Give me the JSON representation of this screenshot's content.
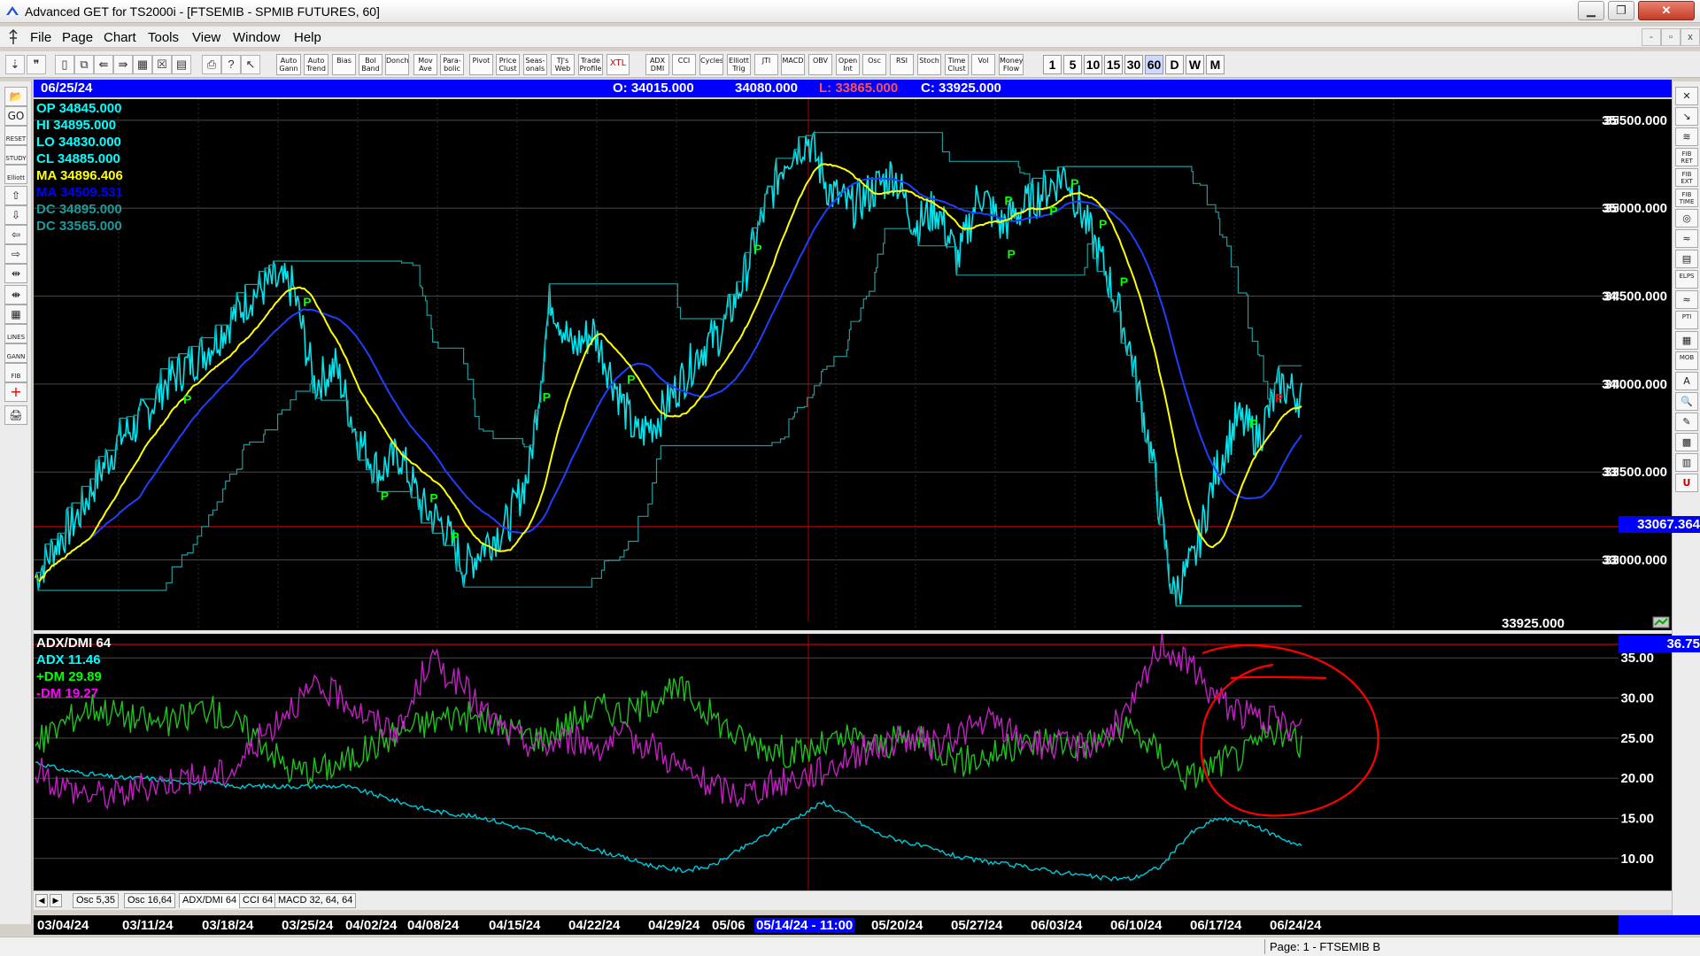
{
  "window": {
    "title": "Advanced GET for TS2000i - [FTSEMIB - SPMIB FUTURES, 60]",
    "min_label": "▁",
    "max_label": "❐",
    "close_label": "✕"
  },
  "menu": {
    "items": [
      "File",
      "Page",
      "Chart",
      "Tools",
      "View",
      "Window",
      "Help"
    ],
    "mdi_min": "-",
    "mdi_restore": "▫",
    "mdi_close": "x"
  },
  "toolbar": {
    "study_buttons": [
      "Auto Gann",
      "Auto Trend",
      "Bias",
      "Bol Band",
      "Donch",
      "Mov Ave",
      "Para- bolic",
      "Pivot",
      "Price Clust",
      "Seas- onals",
      "TJ's Web",
      "Trade Profile",
      "XTL",
      "ADX DMI",
      "CCI",
      "Cycles",
      "Elliott Trig",
      "JTI",
      "MACD",
      "OBV",
      "Open Int",
      "Osc",
      "RSI",
      "Stoch",
      "Time Clust",
      "Vol",
      "Money Flow"
    ],
    "timeframes": [
      "1",
      "5",
      "10",
      "15",
      "30",
      "60",
      "D",
      "W",
      "M"
    ],
    "active_timeframe": "60"
  },
  "left_tools": [
    "📂",
    "GO",
    "RESET",
    "STUDY",
    "Elliott",
    "⇧",
    "⇩",
    "⇦",
    "⇨",
    "⇹",
    "⇼",
    "▦",
    "LINES",
    "GANN",
    "FIB",
    "+",
    "🖨"
  ],
  "right_tools": [
    "✕",
    "↘",
    "≋",
    "FIB RET",
    "FIB EXT",
    "FIB TIME",
    "◎",
    "≈",
    "▤",
    "ELPS",
    "≈",
    "PTI",
    "▦",
    "MOB",
    "A",
    "🔍",
    "✎",
    "▩",
    "▥",
    "U"
  ],
  "header": {
    "date": "06/25/24",
    "open": "O: 34015.000",
    "high": "34080.000",
    "low": "L: 33865.000",
    "close": "C: 33925.000"
  },
  "price_legend": [
    {
      "text": "OP  34845.000",
      "color": "#00ffff"
    },
    {
      "text": "HI   34895.000",
      "color": "#00ffff"
    },
    {
      "text": "LO  34830.000",
      "color": "#00ffff"
    },
    {
      "text": "CL  34885.000",
      "color": "#00ffff"
    },
    {
      "text": "MA  34896.406",
      "color": "#ffff00"
    },
    {
      "text": "MA  34509.531",
      "color": "#0000ff"
    },
    {
      "text": "DC  34895.000",
      "color": "#1e9a9a"
    },
    {
      "text": "DC  33565.000",
      "color": "#1e9a9a"
    }
  ],
  "osc_legend": [
    {
      "text": "ADX/DMI 64",
      "color": "#ffffff"
    },
    {
      "text": "ADX 11.46",
      "color": "#00ffff"
    },
    {
      "text": "+DM 29.89",
      "color": "#00ff00"
    },
    {
      "text": "-DM  19.27",
      "color": "#ff00ff"
    }
  ],
  "price_axis": {
    "ticks": [
      "35500.000",
      "35000.000",
      "34500.000",
      "34000.000",
      "33500.000",
      "33000.000"
    ],
    "current_marker": "33067.364",
    "last_close_label": "33925.000"
  },
  "osc_axis": {
    "ticks": [
      "35.00",
      "30.00",
      "25.00",
      "20.00",
      "15.00",
      "10.00"
    ],
    "current_marker": "36.75"
  },
  "tabs": {
    "items": [
      "Osc 5,35",
      "Osc 16,64",
      "ADX/DMI 64",
      "CCI 64",
      "MACD 32, 64, 64"
    ],
    "active": "ADX/DMI 64"
  },
  "date_axis": {
    "labels": [
      "03/04/24",
      "03/11/24",
      "03/18/24",
      "03/25/24",
      "04/02/24",
      "04/08/24",
      "04/15/24",
      "04/22/24",
      "04/29/24",
      "05/06",
      "05/14/24 - 11:00",
      "05/20/24",
      "05/27/24",
      "06/03/24",
      "06/10/24",
      "06/17/24",
      "06/24/24"
    ],
    "highlight": "05/14/24 - 11:00"
  },
  "pivot_label": "P",
  "status": {
    "page": "Page: 1 - FTSEMIB B"
  },
  "colors": {
    "price_line": "#00e5ee",
    "ma_fast": "#ffff00",
    "ma_slow": "#1f3fff",
    "donchian": "#1e9a9a",
    "adx": "#00c8d8",
    "plus_dm": "#20c020",
    "minus_dm": "#c020c0",
    "annotation": "#ff0000",
    "pivot": "#00ff00"
  },
  "chart_data": {
    "type": "line",
    "price_range": [
      32600,
      35620
    ],
    "osc_range": [
      6,
      38
    ],
    "series": [
      {
        "name": "CL",
        "values": [
          32900,
          33100,
          33250,
          33500,
          33700,
          33800,
          34000,
          34100,
          34200,
          34350,
          34500,
          34580,
          34550,
          34000,
          34100,
          33700,
          33500,
          33600,
          33300,
          33200,
          32950,
          33100,
          33200,
          33500,
          34500,
          34200,
          34300,
          34000,
          33700,
          33800,
          34000,
          34200,
          34300,
          34600,
          35000,
          35300,
          35400,
          35100,
          35000,
          35100,
          35200,
          34900,
          35000,
          34700,
          35100,
          34900,
          35000,
          35100,
          35200,
          34900,
          34600,
          34200,
          33600,
          32800,
          33000,
          33500,
          33800,
          33700,
          34000,
          33925
        ]
      },
      {
        "name": "ADX",
        "values": [
          22,
          21,
          20.5,
          20,
          20,
          19.5,
          19.5,
          19,
          19,
          19,
          19,
          19,
          18,
          17,
          16,
          15.5,
          15,
          14,
          13,
          12,
          11,
          10,
          9,
          8.5,
          9,
          11,
          13,
          15,
          17,
          15,
          13,
          12,
          11,
          10,
          9.5,
          9,
          8.5,
          8,
          7.5,
          7.5,
          9,
          13,
          15,
          14.5,
          13,
          11.5
        ]
      },
      {
        "name": "+DM",
        "values": [
          24,
          27,
          29,
          28,
          27,
          27,
          29,
          27,
          25,
          21,
          21,
          22,
          24,
          26,
          27,
          28,
          27,
          26,
          25,
          27,
          29,
          28,
          30,
          31,
          28,
          25,
          24,
          23,
          24,
          25,
          24,
          25,
          24,
          22,
          23,
          24,
          25,
          24,
          25,
          26,
          23,
          20,
          22,
          23,
          26,
          24
        ]
      },
      {
        "name": "-DM",
        "values": [
          21,
          19,
          18,
          18,
          19,
          20,
          20,
          21,
          25,
          29,
          31,
          30,
          27,
          26,
          35,
          32,
          28,
          25,
          24,
          25,
          24,
          25,
          24,
          21,
          19,
          18,
          19,
          20,
          21,
          23,
          24,
          25,
          24,
          26,
          27,
          25,
          24,
          24,
          25,
          29,
          37,
          34,
          30,
          28,
          27,
          26
        ]
      }
    ],
    "ylabel": "",
    "xlabel": ""
  }
}
